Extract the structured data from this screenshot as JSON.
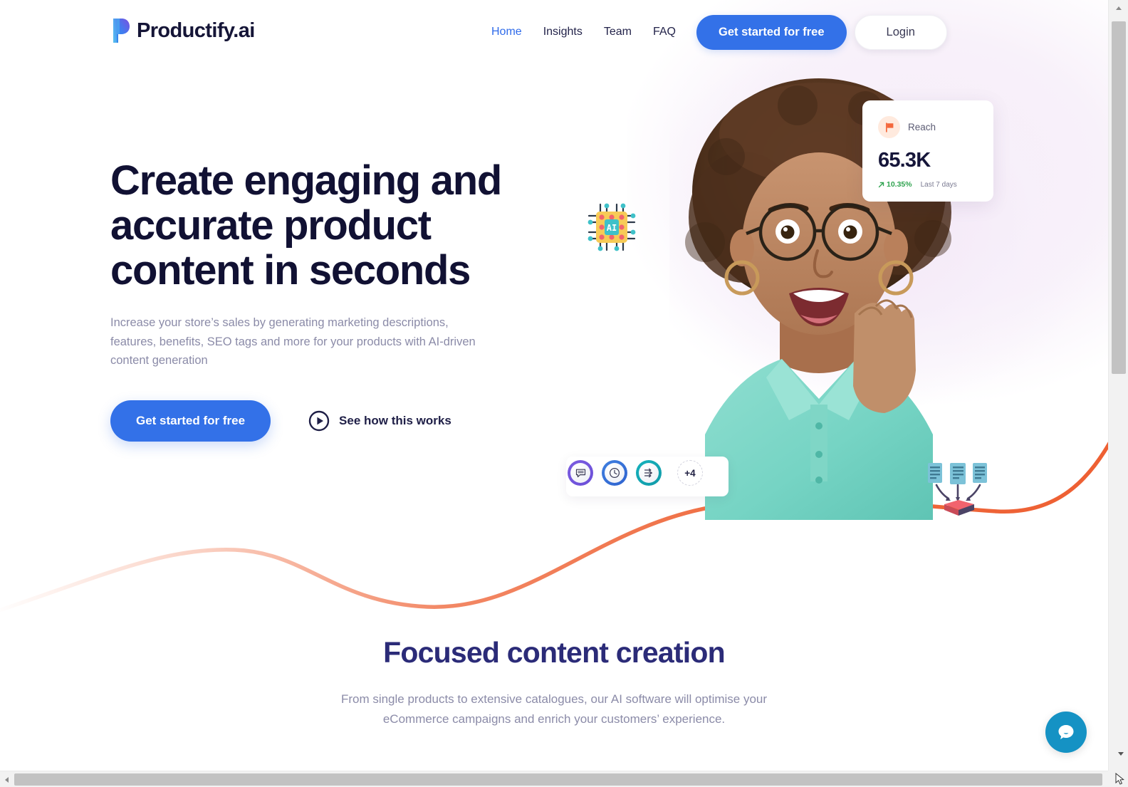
{
  "brand": {
    "logo_text": "Productify.ai",
    "logo_icon": "productify-p-mark",
    "accent_blue": "#3371e8",
    "accent_navy": "#111133",
    "accent_indigo": "#2b2b78",
    "accent_orange": "#f0734a",
    "accent_green": "#2fa34f"
  },
  "nav": {
    "items": [
      {
        "label": "Home",
        "active": true
      },
      {
        "label": "Insights",
        "active": false
      },
      {
        "label": "Team",
        "active": false
      },
      {
        "label": "FAQ",
        "active": false
      }
    ],
    "cta_label": "Get started for free",
    "login_label": "Login"
  },
  "hero": {
    "title": "Create engaging and accurate product content in seconds",
    "subtitle": "Increase your store’s sales by generating marketing descriptions, features, benefits, SEO tags and more for your products with AI-driven content generation",
    "cta_label": "Get started for free",
    "video_link_label": "See how this works",
    "video_icon": "play-circle-icon",
    "art": {
      "chip_icon": "ai-chip-icon",
      "chip_icon_label": "AI",
      "doc_icon": "documents-import-icon",
      "person_photo": "smiling-woman-photo"
    },
    "stat_card": {
      "icon": "flag-icon",
      "label": "Reach",
      "value": "65.3K",
      "delta": "10.35%",
      "delta_direction": "up",
      "period": "Last 7 days"
    },
    "badges": [
      {
        "icon": "chat-bubble-icon",
        "ring_color": "#6b4fd8"
      },
      {
        "icon": "clock-icon",
        "ring_color": "#2f63cf"
      },
      {
        "icon": "flow-arrows-icon",
        "ring_color": "#109aa8"
      }
    ],
    "badge_overflow_label": "+4"
  },
  "section2": {
    "title": "Focused content creation",
    "subtitle": "From single products to extensive catalogues, our AI software will optimise your eCommerce campaigns and enrich your customers’ experience."
  },
  "chat_widget": {
    "icon": "chat-bubble-smile-icon",
    "color": "#1592c4"
  },
  "scrollbars": {
    "vertical_up_icon": "triangle-up-icon",
    "vertical_down_icon": "triangle-down-icon",
    "horizontal_left_icon": "triangle-left-icon",
    "horizontal_right_icon": "triangle-right-icon"
  }
}
